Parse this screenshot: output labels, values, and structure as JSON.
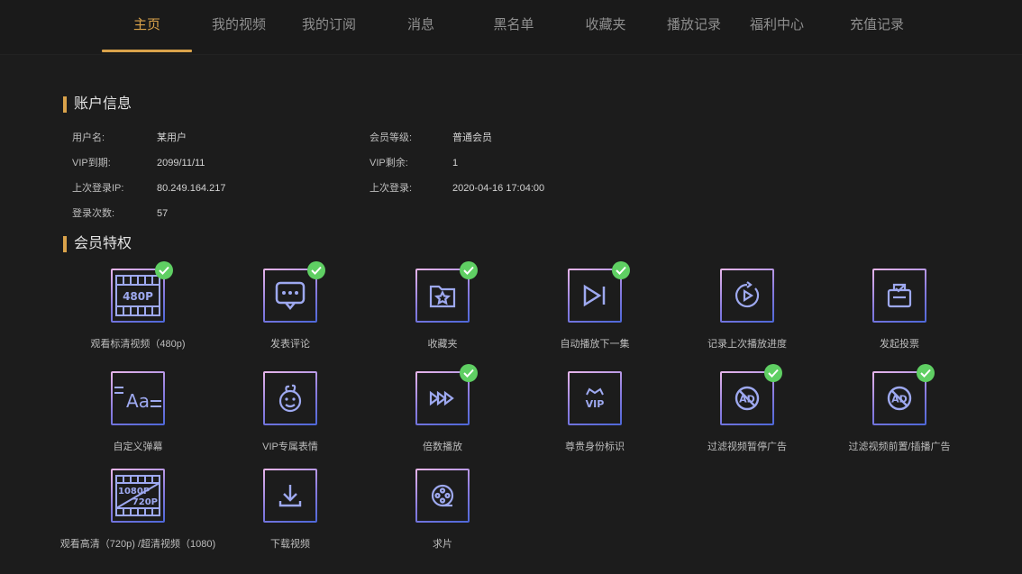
{
  "nav": {
    "tabs": [
      {
        "label": "主页",
        "active": true
      },
      {
        "label": "我的视频"
      },
      {
        "label": "我的订阅"
      },
      {
        "label": "消息"
      },
      {
        "label": "黑名单"
      },
      {
        "label": "收藏夹"
      },
      {
        "label": "播放记录"
      },
      {
        "label": "福利中心"
      },
      {
        "label": "充值记录"
      }
    ]
  },
  "account": {
    "title": "账户信息",
    "username_label": "用户名:",
    "username": "某用户",
    "level_label": "会员等级:",
    "level": "普通会员",
    "vip_expire_label": "VIP到期:",
    "vip_expire": "2099/11/11",
    "vip_remaining_label": "VIP剩余:",
    "vip_remaining": "1",
    "last_ip_label": "上次登录IP:",
    "last_ip": "80.249.164.217",
    "last_login_label": "上次登录:",
    "last_login": "2020-04-16 17:04:00",
    "login_count_label": "登录次数:",
    "login_count": "57"
  },
  "privileges": {
    "title": "会员特权",
    "items": [
      {
        "label": "观看标清视频（480p)",
        "icon": "film-480p-icon",
        "icon_text": "480P",
        "checked": true
      },
      {
        "label": "发表评论",
        "icon": "comment-icon",
        "checked": true
      },
      {
        "label": "收藏夹",
        "icon": "favorite-folder-icon",
        "checked": true
      },
      {
        "label": "自动播放下一集",
        "icon": "play-next-icon",
        "checked": true
      },
      {
        "label": "记录上次播放进度",
        "icon": "replay-progress-icon",
        "checked": false
      },
      {
        "label": "发起投票",
        "icon": "vote-box-icon",
        "checked": false
      },
      {
        "label": "自定义弹幕",
        "icon": "danmaku-text-icon",
        "icon_text": "Aa",
        "checked": false
      },
      {
        "label": "VIP专属表情",
        "icon": "emoji-face-icon",
        "checked": false
      },
      {
        "label": "倍数播放",
        "icon": "fast-forward-icon",
        "checked": true
      },
      {
        "label": "尊贵身份标识",
        "icon": "vip-crown-icon",
        "icon_text": "VIP",
        "checked": false
      },
      {
        "label": "过滤视频暂停广告",
        "icon": "no-ad-pause-icon",
        "icon_text": "AD",
        "checked": true
      },
      {
        "label": "过滤视频前置/插播广告",
        "icon": "no-ad-preroll-icon",
        "icon_text": "AD",
        "checked": true
      },
      {
        "label": "观看高清（720p) /超清视频（1080)",
        "icon": "film-hd-icon",
        "icon_text_top": "1080P",
        "icon_text_bottom": "720P",
        "checked": false
      },
      {
        "label": "下载视频",
        "icon": "download-icon",
        "checked": false
      },
      {
        "label": "求片",
        "icon": "film-reel-icon",
        "checked": false
      }
    ]
  }
}
